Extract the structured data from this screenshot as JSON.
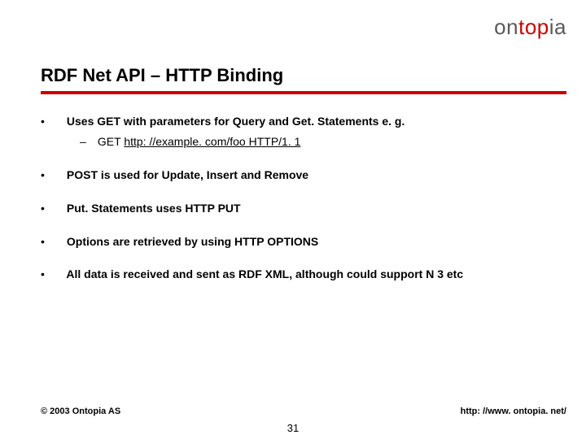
{
  "logo": {
    "part1": "on",
    "part2": "top",
    "part3": "ia"
  },
  "title": "RDF Net API – HTTP Binding",
  "bullets": [
    {
      "text": "Uses GET with parameters for Query and Get. Statements e. g.",
      "sub": [
        {
          "prefix": "GET ",
          "link": "http: //example. com/foo HTTP/1. 1"
        }
      ]
    },
    {
      "text": "POST is used for Update, Insert and Remove"
    },
    {
      "text": "Put. Statements uses HTTP PUT"
    },
    {
      "text": "Options are retrieved by using HTTP OPTIONS"
    },
    {
      "text": "All data is received and sent as RDF XML, although could support N 3 etc"
    }
  ],
  "footer": {
    "copyright": "© 2003 Ontopia AS",
    "url": "http: //www. ontopia. net/",
    "page": "31"
  }
}
